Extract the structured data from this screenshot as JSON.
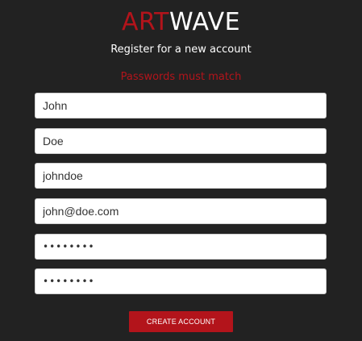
{
  "brand": {
    "part1": "ART",
    "part2": "WAVE",
    "accent_color": "#b3141b"
  },
  "subtitle": "Register for a new account",
  "error_message": "Passwords must match",
  "form": {
    "first_name": "John",
    "last_name": "Doe",
    "username": "johndoe",
    "email": "john@doe.com",
    "password": "abcd1234",
    "confirm_password": "abcd1234"
  },
  "submit_label": "CREATE ACCOUNT"
}
